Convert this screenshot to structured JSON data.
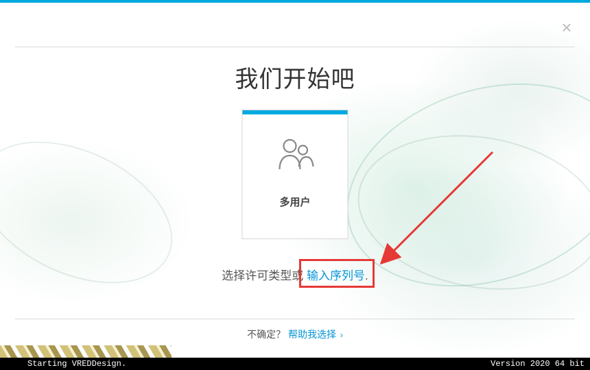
{
  "heading": "我们开始吧",
  "card": {
    "label": "多用户",
    "icon": "users-icon"
  },
  "prompt": {
    "prefix": "选择许可类型或 ",
    "link": "输入序列号",
    "suffix": "."
  },
  "footer": {
    "question": "不确定？",
    "help_link": "帮助我选择",
    "chevron": "›"
  },
  "statusbar": {
    "left": "Starting VREDDesign.",
    "right": "Version 2020  64 bit"
  },
  "colors": {
    "accent": "#00a9e0",
    "link": "#0696d7",
    "highlight_border": "#e53935"
  }
}
